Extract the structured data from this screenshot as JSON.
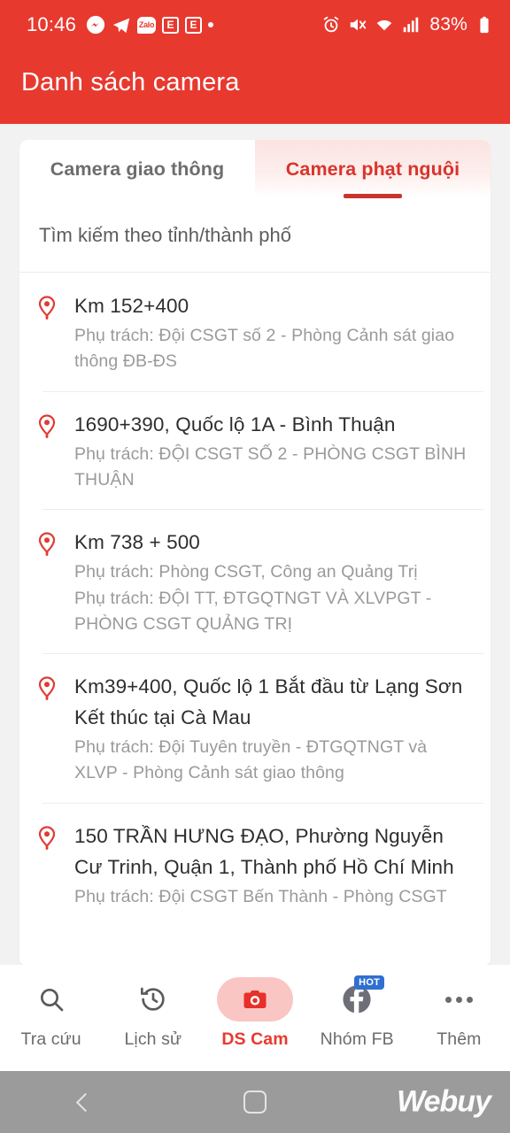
{
  "status_bar": {
    "time": "10:46",
    "left_icons": [
      "messenger-icon",
      "telegram-icon",
      "zalo-icon",
      "app-e-icon",
      "app-e-icon",
      "dot-icon"
    ],
    "zalo_label": "Zalo",
    "app_e_label": "E",
    "right_icons": [
      "alarm-icon",
      "mute-icon",
      "wifi-icon",
      "signal-icon",
      "battery-icon"
    ],
    "battery_percent": "83%"
  },
  "app_bar": {
    "title": "Danh sách camera",
    "background_color": "#e8392f"
  },
  "tabs": [
    {
      "label": "Camera giao thông",
      "active": false
    },
    {
      "label": "Camera phạt nguội",
      "active": true
    }
  ],
  "search": {
    "placeholder": "Tìm kiếm theo tỉnh/thành phố",
    "value": ""
  },
  "camera_list": [
    {
      "title": "Km 152+400",
      "subtitles": [
        "Phụ trách: Đội CSGT số 2 - Phòng Cảnh sát giao thông ĐB-ĐS"
      ]
    },
    {
      "title": "1690+390, Quốc lộ 1A - Bình Thuận",
      "subtitles": [
        "Phụ trách: ĐỘI CSGT SỐ 2 - PHÒNG CSGT BÌNH THUẬN"
      ]
    },
    {
      "title": "Km 738 + 500",
      "subtitles": [
        "Phụ trách: Phòng CSGT, Công an  Quảng Trị",
        "Phụ trách: ĐỘI TT, ĐTGQTNGT VÀ XLVPGT - PHÒNG CSGT QUẢNG TRỊ"
      ]
    },
    {
      "title": "Km39+400, Quốc lộ 1 Bắt đầu từ Lạng Sơn Kết thúc tại Cà Mau",
      "subtitles": [
        "Phụ trách: Đội Tuyên truyền - ĐTGQTNGT và XLVP - Phòng Cảnh sát giao thông"
      ]
    },
    {
      "title": "150 TRẦN HƯNG ĐẠO, Phường Nguyễn Cư Trinh, Quận 1, Thành phố Hồ Chí Minh",
      "subtitles": [
        "Phụ trách: Đội CSGT Bến Thành - Phòng CSGT"
      ]
    }
  ],
  "bottom_nav": [
    {
      "label": "Tra cứu",
      "icon": "search-icon",
      "active": false
    },
    {
      "label": "Lịch sử",
      "icon": "history-icon",
      "active": false
    },
    {
      "label": "DS Cam",
      "icon": "camera-icon",
      "active": true
    },
    {
      "label": "Nhóm FB",
      "icon": "facebook-icon",
      "active": false,
      "badge": "HOT"
    },
    {
      "label": "Thêm",
      "icon": "more-icon",
      "active": false
    }
  ],
  "system_nav": {
    "back": "back-icon",
    "home": "home-icon",
    "watermark": "Webuy"
  },
  "colors": {
    "brand_red": "#e8392f",
    "tab_active_red": "#d9342b",
    "page_bg": "#f2f2f2",
    "pin_red": "#e03b34"
  }
}
